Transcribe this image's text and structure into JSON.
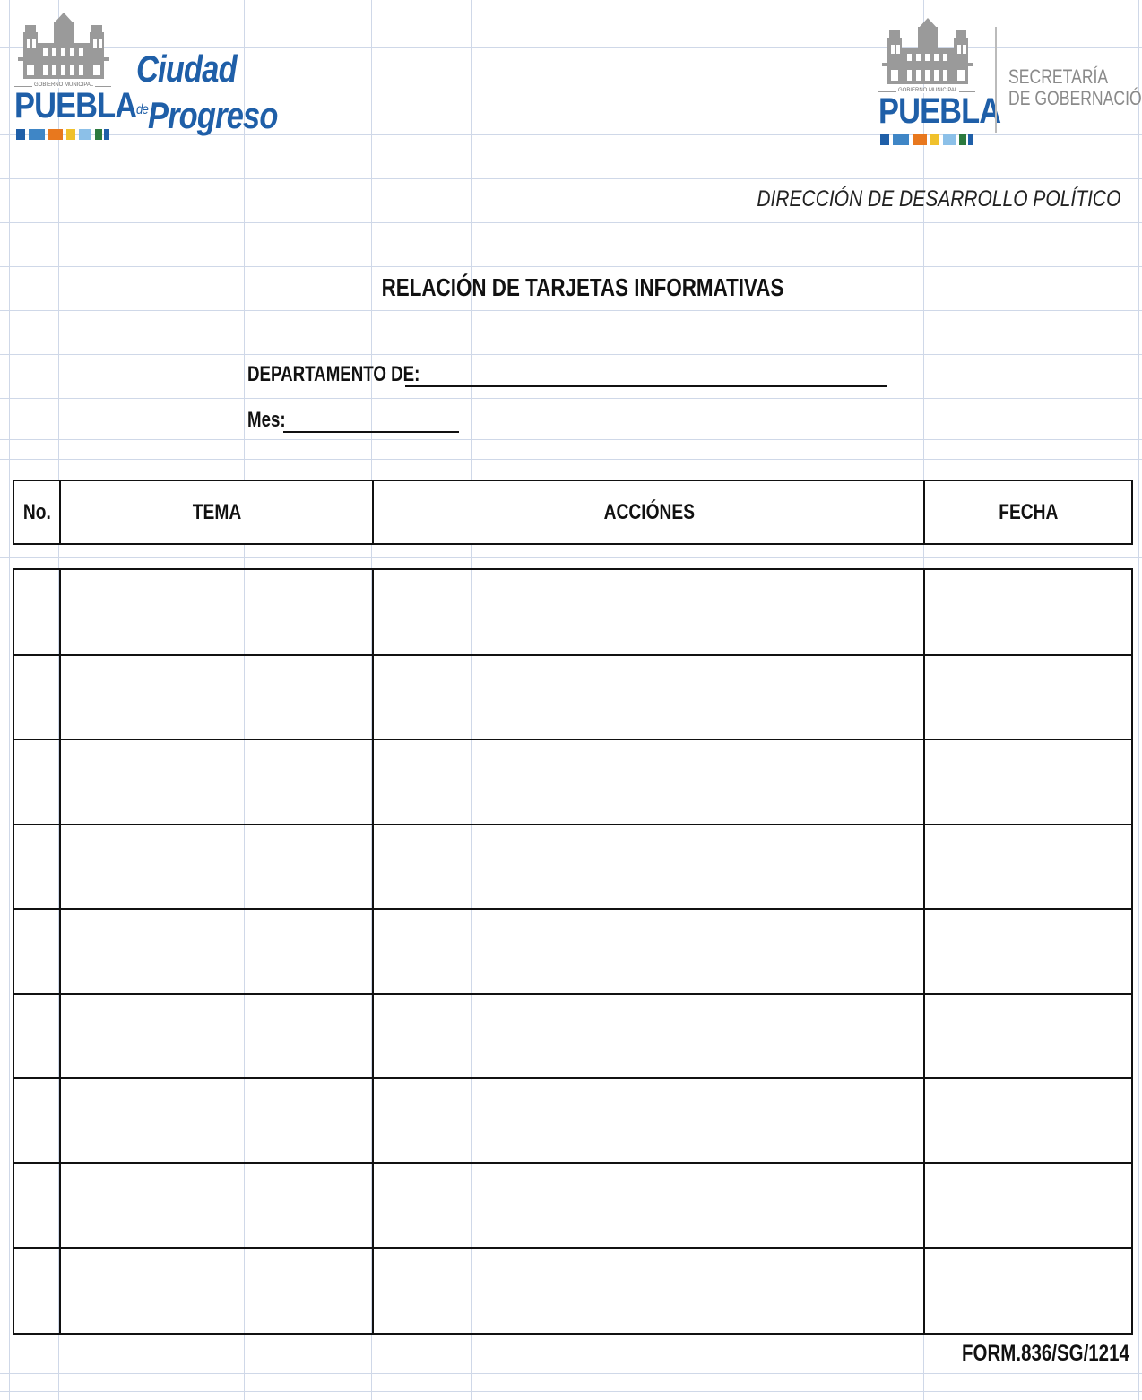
{
  "header": {
    "left_logo": {
      "gobierno_text": "GOBIERNO MUNICIPAL",
      "puebla_text": "PUEBLA",
      "ciudad_text": "Ciudad",
      "de_text": "de",
      "progreso_text": "Progreso"
    },
    "right_logo": {
      "gobierno_text": "GOBIERNO MUNICIPAL",
      "puebla_text": "PUEBLA",
      "secretaria_line1": "SECRETARÍA",
      "secretaria_line2": "DE GOBERNACIÓN"
    },
    "direccion": "DIRECCIÓN DE DESARROLLO POLÍTICO"
  },
  "form": {
    "title": "RELACIÓN DE TARJETAS INFORMATIVAS",
    "departamento_label": "DEPARTAMENTO DE:",
    "mes_label": "Mes:",
    "departamento_value": "",
    "mes_value": ""
  },
  "table": {
    "columns": [
      "No.",
      "TEMA",
      "ACCIÓNES",
      "FECHA"
    ],
    "rows": [
      [
        "",
        "",
        "",
        ""
      ],
      [
        "",
        "",
        "",
        ""
      ],
      [
        "",
        "",
        "",
        ""
      ],
      [
        "",
        "",
        "",
        ""
      ],
      [
        "",
        "",
        "",
        ""
      ],
      [
        "",
        "",
        "",
        ""
      ],
      [
        "",
        "",
        "",
        ""
      ],
      [
        "",
        "",
        "",
        ""
      ],
      [
        "",
        "",
        "",
        ""
      ]
    ]
  },
  "footer": {
    "form_code": "FORM.836/SG/1214"
  },
  "colors": {
    "brand_blue": "#1f5fa8",
    "gridline": "#cfd8e8",
    "stripe_colors": [
      "#1f5fa8",
      "#3f86c6",
      "#e8781e",
      "#f0c12c",
      "#8cc0e8",
      "#2c7a3e"
    ]
  }
}
